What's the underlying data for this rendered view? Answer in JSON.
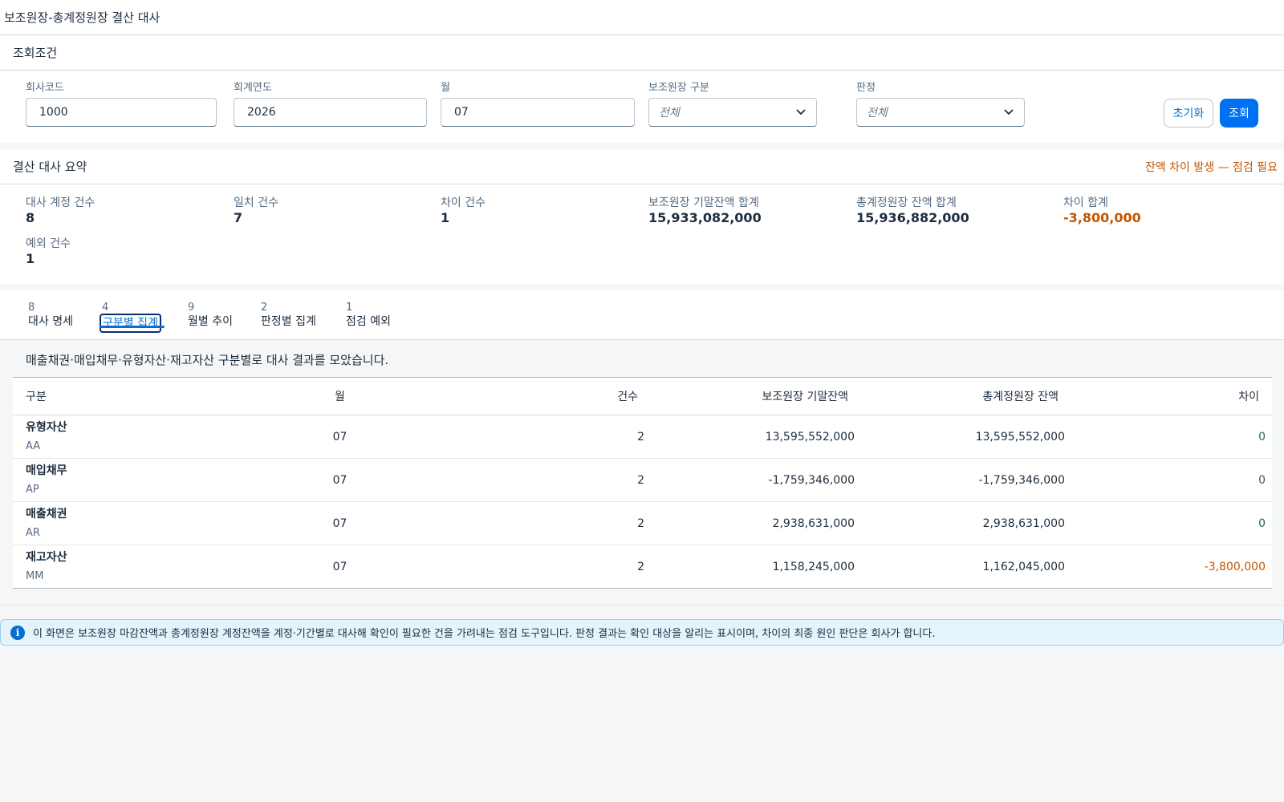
{
  "page": {
    "title": "보조원장-총계정원장 결산 대사"
  },
  "filters": {
    "title": "조회조건",
    "company_code": {
      "label": "회사코드",
      "value": "1000"
    },
    "fiscal_year": {
      "label": "회계연도",
      "value": "2026"
    },
    "month": {
      "label": "월",
      "value": "07"
    },
    "subledger_type": {
      "label": "보조원장 구분",
      "value": "전체"
    },
    "judgement": {
      "label": "판정",
      "value": "전체"
    },
    "reset_label": "초기화",
    "search_label": "조회"
  },
  "summary": {
    "title": "결산 대사 요약",
    "warning": "잔액 차이 발생 — 점검 필요",
    "kpis": [
      {
        "label": "대사 계정 건수",
        "value": "8"
      },
      {
        "label": "일치 건수",
        "value": "7"
      },
      {
        "label": "차이 건수",
        "value": "1"
      },
      {
        "label": "보조원장 기말잔액 합계",
        "value": "15,933,082,000"
      },
      {
        "label": "총계정원장 잔액 합계",
        "value": "15,936,882,000"
      },
      {
        "label": "차이 합계",
        "value": "-3,800,000"
      },
      {
        "label": "예외 건수",
        "value": "1"
      }
    ]
  },
  "tabs": [
    {
      "count": "8",
      "label": "대사 명세"
    },
    {
      "count": "4",
      "label": "구분별 집계",
      "active": true
    },
    {
      "count": "9",
      "label": "월별 추이"
    },
    {
      "count": "2",
      "label": "판정별 집계"
    },
    {
      "count": "1",
      "label": "점검 예외"
    }
  ],
  "content": {
    "description": "매출채권·매입채무·유형자산·재고자산 구분별로 대사 결과를 모았습니다.",
    "columns": [
      "구분",
      "월",
      "건수",
      "보조원장 기말잔액",
      "총계정원장 잔액",
      "차이"
    ],
    "rows": [
      {
        "name": "유형자산",
        "code": "AA",
        "month": "07",
        "count": "2",
        "sub": "13,595,552,000",
        "gl": "13,595,552,000",
        "diff": "0"
      },
      {
        "name": "매입채무",
        "code": "AP",
        "month": "07",
        "count": "2",
        "sub": "-1,759,346,000",
        "gl": "-1,759,346,000",
        "diff": "0"
      },
      {
        "name": "매출채권",
        "code": "AR",
        "month": "07",
        "count": "2",
        "sub": "2,938,631,000",
        "gl": "2,938,631,000",
        "diff": "0"
      },
      {
        "name": "재고자산",
        "code": "MM",
        "month": "07",
        "count": "2",
        "sub": "1,158,245,000",
        "gl": "1,162,045,000",
        "diff": "-3,800,000"
      }
    ]
  },
  "info": {
    "icon": "info-icon",
    "text": "이 화면은 보조원장 마감잔액과 총계정원장 계정잔액을 계정·기간별로 대사해 확인이 필요한 건을 가려내는 점검 도구입니다. 판정 결과는 확인 대상을 알리는 표시이며, 차이의 최종 원인 판단은 회사가 합니다."
  },
  "colors": {
    "accent": "#0070f2",
    "warning": "#c35500",
    "positive": "#256f3a"
  }
}
